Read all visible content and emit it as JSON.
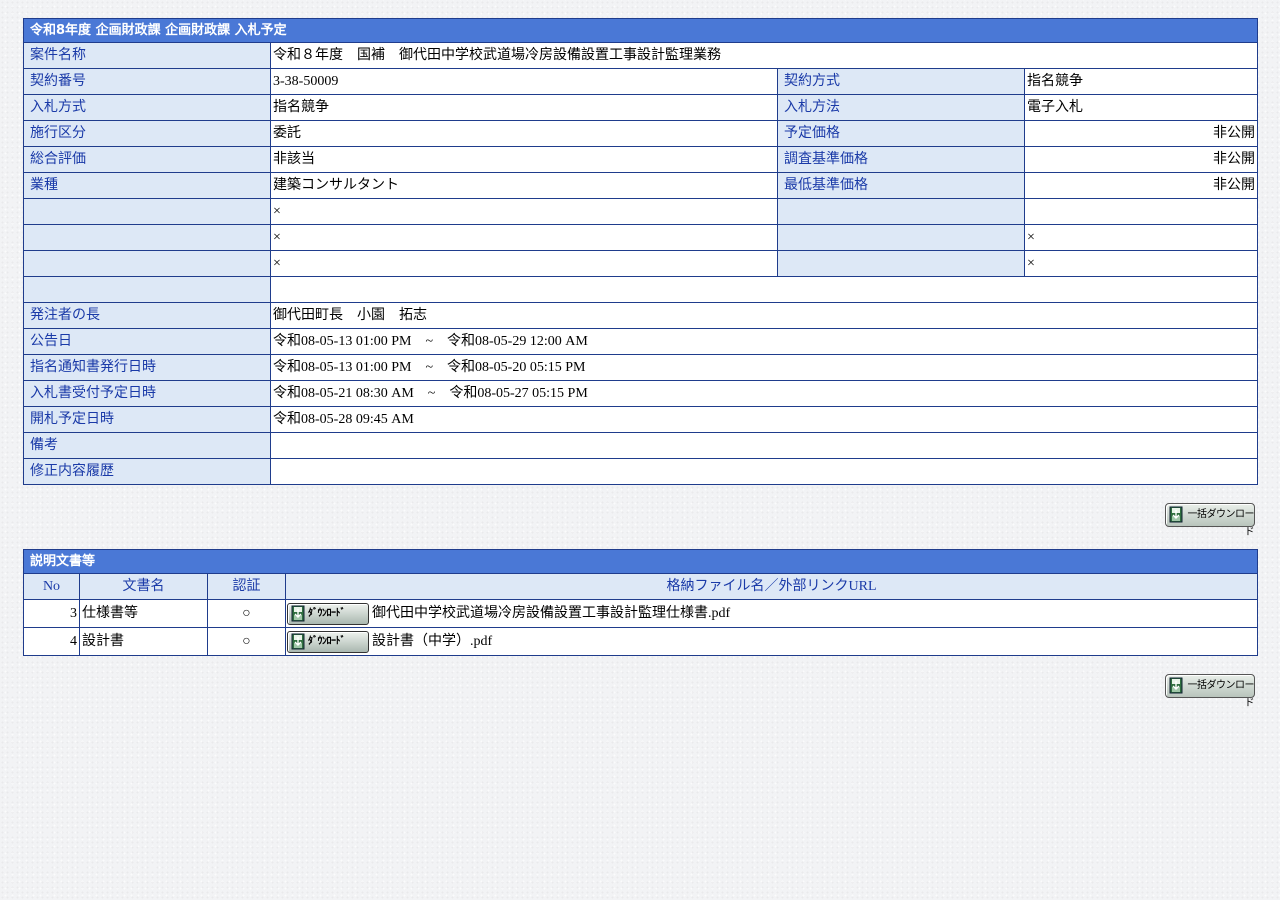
{
  "info": {
    "title": "令和8年度 企画財政課 企画財政課 入札予定",
    "rows": {
      "case_name": {
        "label": "案件名称",
        "value": "令和８年度　国補　御代田中学校武道場冷房設備設置工事設計監理業務"
      },
      "contract_no": {
        "label": "契約番号",
        "value": "3-38-50009"
      },
      "contract_method": {
        "label": "契約方式",
        "value": "指名競争"
      },
      "bid_method": {
        "label": "入札方式",
        "value": "指名競争"
      },
      "bid_procedure": {
        "label": "入札方法",
        "value": "電子入札"
      },
      "execution_type": {
        "label": "施行区分",
        "value": "委託"
      },
      "planned_price": {
        "label": "予定価格",
        "value": "非公開"
      },
      "overall_eval": {
        "label": "総合評価",
        "value": "非該当"
      },
      "survey_price": {
        "label": "調査基準価格",
        "value": "非公開"
      },
      "industry": {
        "label": "業種",
        "value": "建築コンサルタント"
      },
      "min_price": {
        "label": "最低基準価格",
        "value": "非公開"
      },
      "blank_mark": "×",
      "orderer_head": {
        "label": "発注者の長",
        "value": "御代田町長　小園　拓志"
      },
      "announce_date": {
        "label": "公告日",
        "value": "令和08-05-13 01:00 PM　~　令和08-05-29 12:00 AM"
      },
      "notice_date": {
        "label": "指名通知書発行日時",
        "value": "令和08-05-13 01:00 PM　~　令和08-05-20 05:15 PM"
      },
      "bid_accept_date": {
        "label": "入札書受付予定日時",
        "value": "令和08-05-21 08:30 AM　~　令和08-05-27 05:15 PM"
      },
      "opening_date": {
        "label": "開札予定日時",
        "value": "令和08-05-28 09:45 AM"
      },
      "remarks": {
        "label": "備考",
        "value": ""
      },
      "revision_history": {
        "label": "修正内容履歴",
        "value": ""
      }
    }
  },
  "bulk_download_label": "一括ダウンロード",
  "docs": {
    "title": "説明文書等",
    "columns": [
      "No",
      "文書名",
      "認証",
      "格納ファイル名／外部リンクURL"
    ],
    "download_label": "ﾀﾞｳﾝﾛｰﾄﾞ",
    "items": [
      {
        "no": "3",
        "name": "仕様書等",
        "auth": "○",
        "file": "御代田中学校武道場冷房設備設置工事設計監理仕様書.pdf"
      },
      {
        "no": "4",
        "name": "設計書",
        "auth": "○",
        "file": "設計書（中学）.pdf"
      }
    ]
  },
  "colors": {
    "header_blue": "#4a78d6",
    "label_bg": "#dde8f6",
    "label_text": "#1a3aa8",
    "border": "#1f3c8c"
  },
  "icons": [
    "disk-download-icon"
  ]
}
